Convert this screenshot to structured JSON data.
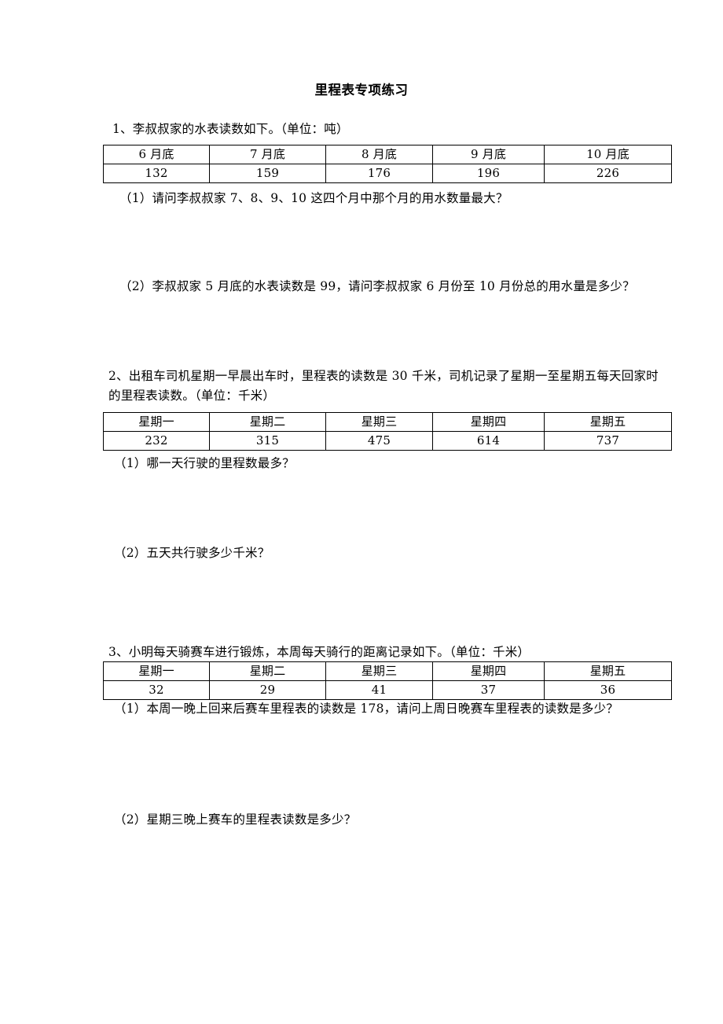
{
  "document": {
    "title": "里程表专项练习"
  },
  "problems": [
    {
      "id": "p1",
      "stem": "1、李叔叔家的水表读数如下。（单位：吨）",
      "table": {
        "headers": [
          "6 月底",
          "7 月底",
          "8 月底",
          "9 月底",
          "10 月底"
        ],
        "values": [
          "132",
          "159",
          "176",
          "196",
          "226"
        ]
      },
      "questions": [
        "（1）请问李叔叔家 7、8、9、10 这四个月中那个月的用水数量最大？",
        "（2）李叔叔家 5 月底的水表读数是 99，请问李叔叔家 6 月份至 10 月份总的用水量是多少？"
      ]
    },
    {
      "id": "p2",
      "stem": "2、出租车司机星期一早晨出车时，里程表的读数是 30 千米，司机记录了星期一至星期五每天回家时的里程表读数。（单位：千米）",
      "table": {
        "headers": [
          "星期一",
          "星期二",
          "星期三",
          "星期四",
          "星期五"
        ],
        "values": [
          "232",
          "315",
          "475",
          "614",
          "737"
        ]
      },
      "questions": [
        "（1）哪一天行驶的里程数最多？",
        "（2）五天共行驶多少千米？"
      ]
    },
    {
      "id": "p3",
      "stem": "3、小明每天骑赛车进行锻炼，本周每天骑行的距离记录如下。（单位：千米）",
      "table": {
        "headers": [
          "星期一",
          "星期二",
          "星期三",
          "星期四",
          "星期五"
        ],
        "values": [
          "32",
          "29",
          "41",
          "37",
          "36"
        ]
      },
      "questions": [
        "（1）本周一晚上回来后赛车里程表的读数是 178，请问上周日晚赛车里程表的读数是多少？",
        "（2）星期三晚上赛车的里程表读数是多少？"
      ]
    }
  ]
}
